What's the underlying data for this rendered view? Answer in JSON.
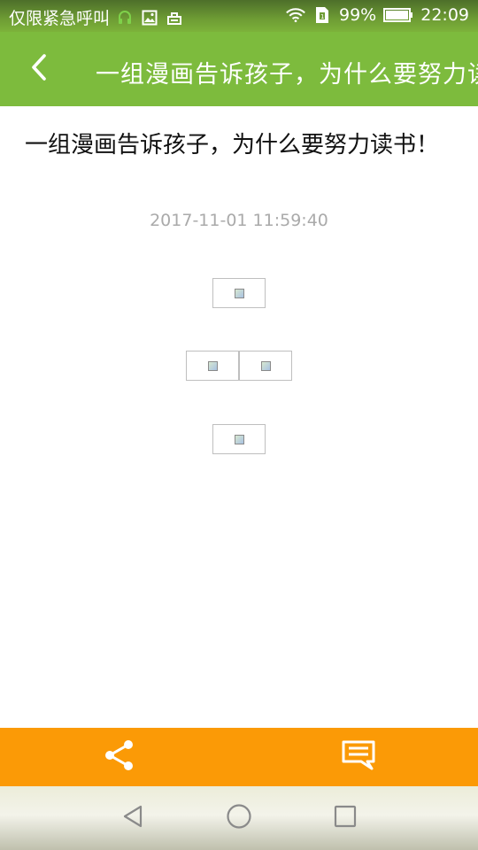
{
  "status_bar": {
    "carrier": "仅限紧急呼叫",
    "battery": "99%",
    "time": "22:09",
    "icons": [
      "headset-icon",
      "image-icon",
      "notification-icon",
      "wifi-icon",
      "sim-icon",
      "battery-icon"
    ]
  },
  "app_bar": {
    "back_icon": "chevron-left-icon",
    "title": "一组漫画告诉孩子，为什么要努力读书！"
  },
  "article": {
    "title": "一组漫画告诉孩子，为什么要努力读书！",
    "time": "2017-11-01 11:59:40",
    "images": [
      "broken-image-icon",
      "broken-image-icon",
      "broken-image-icon",
      "broken-image-icon"
    ]
  },
  "bottom_bar": {
    "share_icon": "share-icon",
    "comment_icon": "comment-icon"
  },
  "nav_bar": {
    "back_icon": "triangle-back-icon",
    "home_icon": "circle-home-icon",
    "recents_icon": "square-recents-icon"
  },
  "colors": {
    "app_bar": "#7dbb3d",
    "bottom_bar": "#fb9a06",
    "timestamp": "#aaaaaa",
    "title_text": "#111111"
  }
}
